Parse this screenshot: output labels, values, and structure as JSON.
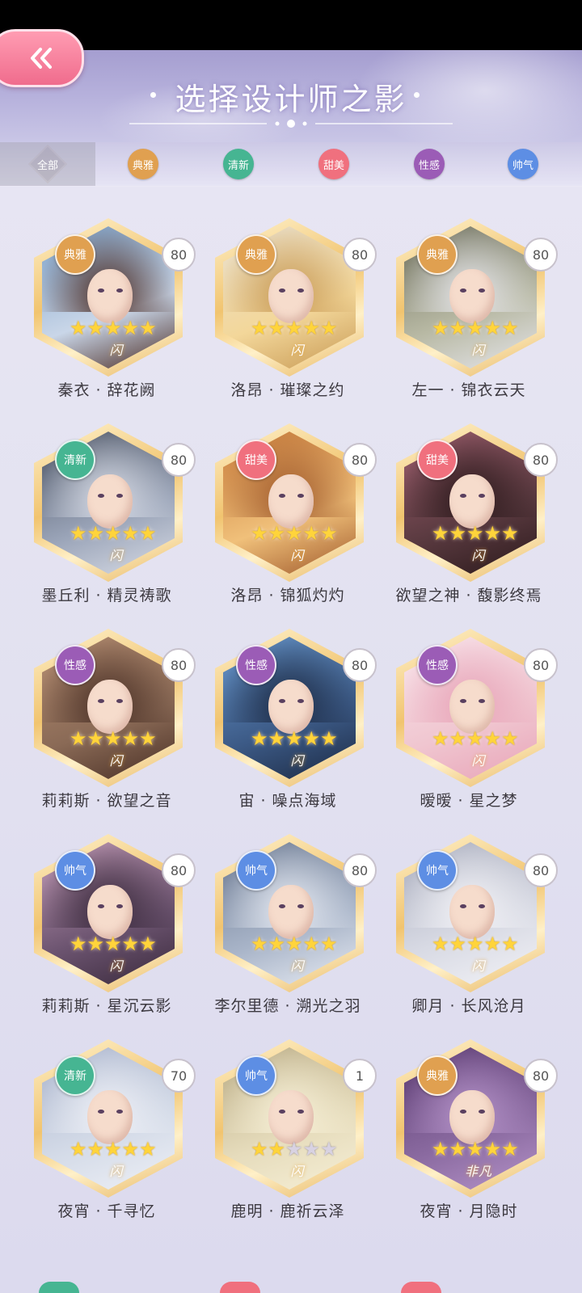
{
  "header": {
    "title": "选择设计师之影"
  },
  "filters": [
    {
      "label": "全部",
      "color": "#7c6a64",
      "active": true
    },
    {
      "label": "典雅",
      "color": "#e0a050",
      "active": false
    },
    {
      "label": "清新",
      "color": "#46b592",
      "active": false
    },
    {
      "label": "甜美",
      "color": "#f0707e",
      "active": false
    },
    {
      "label": "性感",
      "color": "#9b5cb6",
      "active": false
    },
    {
      "label": "帅气",
      "color": "#5d8ee4",
      "active": false
    }
  ],
  "colors": {
    "典雅": "#e0a050",
    "清新": "#46b592",
    "甜美": "#f0707e",
    "性感": "#9b5cb6",
    "帅气": "#5d8ee4",
    "back_button": "#f27a98",
    "stars": "#ffd43b"
  },
  "cards": [
    {
      "name": "秦衣 · 辞花阙",
      "style": "典雅",
      "level": "80",
      "stars": 5,
      "flash": "闪"
    },
    {
      "name": "洛昂 · 璀璨之约",
      "style": "典雅",
      "level": "80",
      "stars": 5,
      "flash": "闪"
    },
    {
      "name": "左一 · 锦衣云天",
      "style": "典雅",
      "level": "80",
      "stars": 5,
      "flash": "闪"
    },
    {
      "name": "墨丘利 · 精灵祷歌",
      "style": "清新",
      "level": "80",
      "stars": 5,
      "flash": "闪"
    },
    {
      "name": "洛昂 · 锦狐灼灼",
      "style": "甜美",
      "level": "80",
      "stars": 5,
      "flash": "闪"
    },
    {
      "name": "欲望之神 · 馥影终焉",
      "style": "甜美",
      "level": "80",
      "stars": 5,
      "flash": "闪"
    },
    {
      "name": "莉莉斯 · 欲望之音",
      "style": "性感",
      "level": "80",
      "stars": 5,
      "flash": "闪"
    },
    {
      "name": "宙 · 噪点海域",
      "style": "性感",
      "level": "80",
      "stars": 5,
      "flash": "闪"
    },
    {
      "name": "暧暧 · 星之梦",
      "style": "性感",
      "level": "80",
      "stars": 5,
      "flash": "闪"
    },
    {
      "name": "莉莉斯 · 星沉云影",
      "style": "帅气",
      "level": "80",
      "stars": 5,
      "flash": "闪"
    },
    {
      "name": "李尔里德 · 溯光之羽",
      "style": "帅气",
      "level": "80",
      "stars": 5,
      "flash": "闪"
    },
    {
      "name": "卿月 · 长风沧月",
      "style": "帅气",
      "level": "80",
      "stars": 5,
      "flash": "闪"
    },
    {
      "name": "夜宵 · 千寻忆",
      "style": "清新",
      "level": "70",
      "stars": 5,
      "flash": "闪"
    },
    {
      "name": "鹿明 · 鹿祈云泽",
      "style": "帅气",
      "level": "1",
      "stars": 2,
      "flash": "闪"
    },
    {
      "name": "夜宵 · 月隐时",
      "style": "典雅",
      "level": "80",
      "stars": 5,
      "flash": "非凡"
    }
  ]
}
